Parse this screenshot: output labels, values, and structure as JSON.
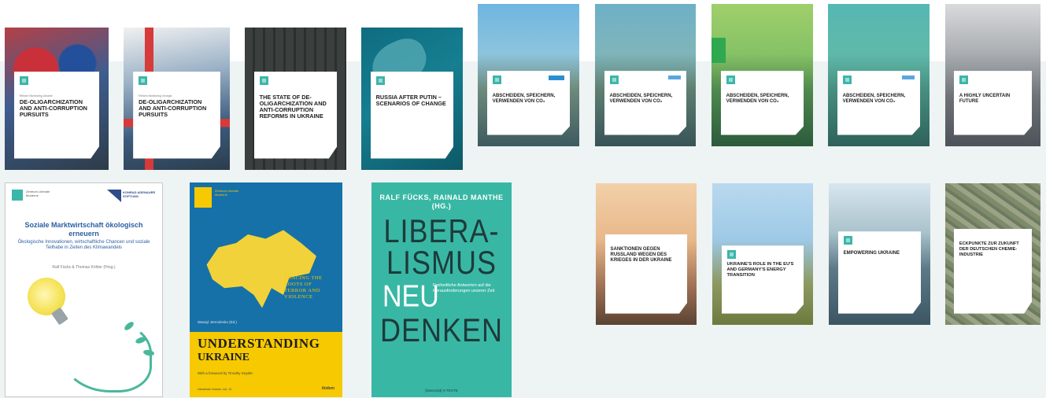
{
  "colors": {
    "accent": "#3bb6a9",
    "background_band": "#eef3f3"
  },
  "covers_row1": [
    {
      "series": "Reform Monitoring Ukraine",
      "title": "DE-OLIGARCHIZATION AND ANTI-CORRUPTION PURSUITS",
      "image": "protest-flags"
    },
    {
      "series": "Reform Monitoring Georgia",
      "title": "DE-OLIGARCHIZATION AND ANTI-CORRUPTION PURSUITS",
      "image": "georgian-flags"
    },
    {
      "series": "",
      "title": "THE STATE OF DE-OLIGARCHIZATION AND ANTI-CORRUPTION REFORMS IN UKRAINE",
      "image": "buildings"
    },
    {
      "series": "",
      "title": "RUSSIA AFTER PUTIN – SCENARIOS OF CHANGE",
      "image": "fish"
    },
    {
      "series": "",
      "title": "ABSCHEIDEN, SPEICHERN, VERWENDEN VON CO₂",
      "image": "landscape-sky"
    },
    {
      "series": "",
      "title": "ABSCHEIDEN, SPEICHERN, VERWENDEN VON CO₂",
      "image": "landscape-sky"
    },
    {
      "series": "",
      "title": "ABSCHEIDEN, SPEICHERN, VERWENDEN VON CO₂",
      "image": "landscape-green"
    },
    {
      "series": "",
      "title": "ABSCHEIDEN, SPEICHERN, VERWENDEN VON CO₂",
      "image": "landscape-teal"
    },
    {
      "series": "",
      "title": "A HIGHLY UNCERTAIN FUTURE",
      "image": "city"
    }
  ],
  "soziale": {
    "org_a": "Zentrum Liberale Moderne",
    "org_b": "KONRAD ADENAUER STIFTUNG",
    "title": "Soziale Marktwirtschaft ökologisch erneuern",
    "subtitle": "Ökologische Innovationen, wirtschaftliche Chancen und soziale Teilhabe in Zeiten des Klimawandels",
    "authors": "Ralf Fücks & Thomas Köhler (Hrsg.)"
  },
  "ukraine": {
    "tagline": "Zentrum Liberale Moderne",
    "tracing": "TRACING THE ROOTS OF TERROR AND VIOLENCE",
    "authors": "Wassyl Jermolenko (Ed.)",
    "title_line1": "UNDERSTANDING",
    "title_line2": "UKRAINE",
    "foreword": "With a foreword by Timothy Snyder",
    "series": "Ukrainian Voices, vol. 11",
    "publisher": "ibidem"
  },
  "liberalismus": {
    "authors": "RALF FÜCKS, RAINALD MANTHE (HG.)",
    "line1": "LIBERA-",
    "line2": "LISMUS",
    "line3": "NEU",
    "line4": "DENKEN",
    "subtitle": "Freiheitliche Antworten auf die Herausforderungen unserer Zeit",
    "publisher": "[transcript] X-TEXTE"
  },
  "covers_row2": [
    {
      "series": "",
      "title": "SANKTIONEN GEGEN RUSSLAND WEGEN DES KRIEGES IN DER UKRAINE",
      "image": "refinery"
    },
    {
      "series": "",
      "title": "UKRAINE'S ROLE IN THE EU'S AND GERMANY'S ENERGY TRANSITION",
      "image": "pylon"
    },
    {
      "series": "",
      "title": "EMPOWERING UKRAINE",
      "image": "solar"
    },
    {
      "series": "",
      "title": "ECKPUNKTE ZUR ZUKUNFT DER DEUTSCHEN CHEMIE-INDUSTRIE",
      "image": "aerial"
    }
  ]
}
